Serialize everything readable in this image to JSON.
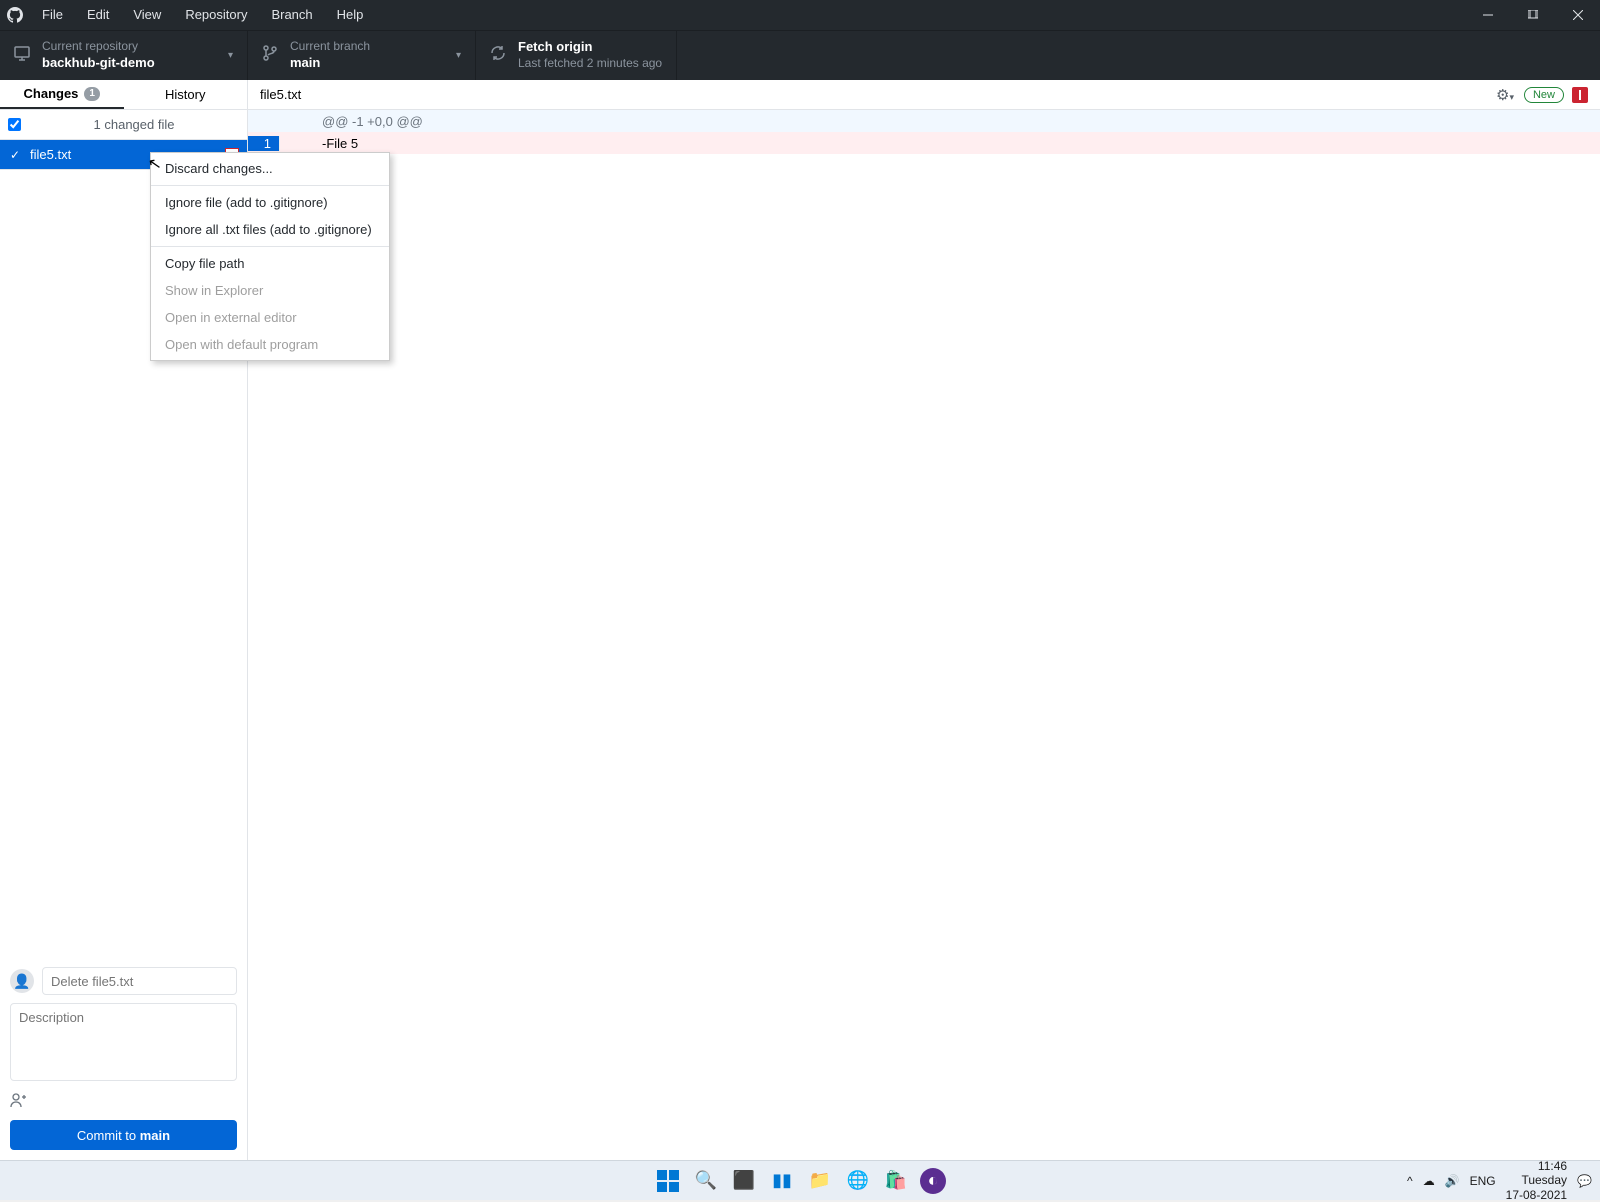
{
  "menubar": {
    "items": [
      "File",
      "Edit",
      "View",
      "Repository",
      "Branch",
      "Help"
    ]
  },
  "toolbar": {
    "repo": {
      "label": "Current repository",
      "value": "backhub-git-demo"
    },
    "branch": {
      "label": "Current branch",
      "value": "main"
    },
    "fetch": {
      "label": "Fetch origin",
      "value": "Last fetched 2 minutes ago"
    }
  },
  "sidebar": {
    "tabs": {
      "changes": "Changes",
      "changes_count": "1",
      "history": "History"
    },
    "changed_header": "1 changed file",
    "file": {
      "name": "file5.txt"
    }
  },
  "diff": {
    "header_file": "file5.txt",
    "new_badge": "New",
    "hunk": "@@ -1 +0,0 @@",
    "deleted_line_num": "1",
    "deleted_line": "-File 5"
  },
  "commit": {
    "summary_placeholder": "Delete file5.txt",
    "desc_placeholder": "Description",
    "button_prefix": "Commit to ",
    "button_branch": "main"
  },
  "context_menu": {
    "items": [
      {
        "label": "Discard changes...",
        "enabled": true
      },
      {
        "sep": true
      },
      {
        "label": "Ignore file (add to .gitignore)",
        "enabled": true
      },
      {
        "label": "Ignore all .txt files (add to .gitignore)",
        "enabled": true
      },
      {
        "sep": true
      },
      {
        "label": "Copy file path",
        "enabled": true
      },
      {
        "label": "Show in Explorer",
        "enabled": false
      },
      {
        "label": "Open in external editor",
        "enabled": false
      },
      {
        "label": "Open with default program",
        "enabled": false
      }
    ]
  },
  "taskbar": {
    "lang": "ENG",
    "time": "11:46",
    "day": "Tuesday",
    "date": "17-08-2021"
  }
}
